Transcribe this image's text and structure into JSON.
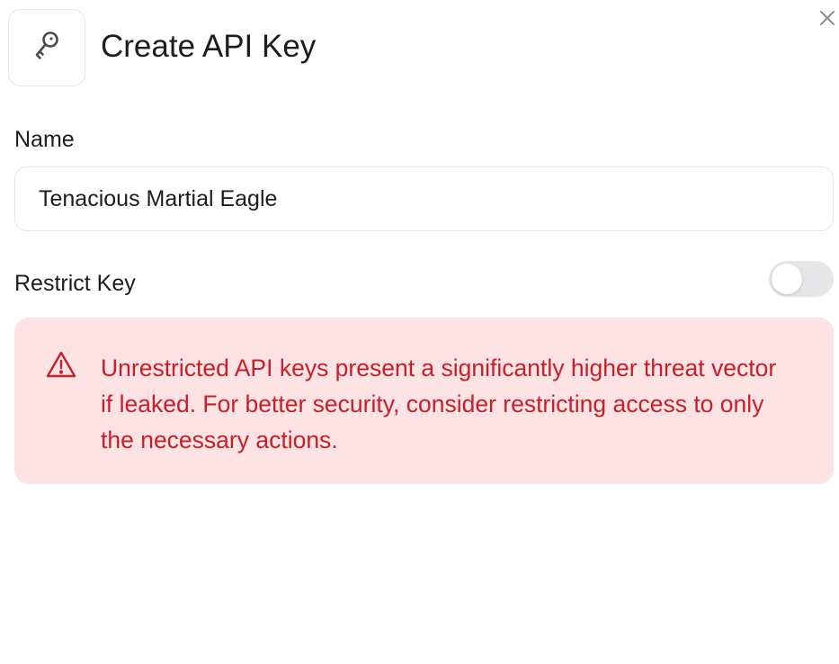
{
  "dialog": {
    "title": "Create API Key",
    "header_icon": "key-icon",
    "close_icon": "close-icon"
  },
  "name_field": {
    "label": "Name",
    "value": "Tenacious Martial Eagle"
  },
  "restrict": {
    "label": "Restrict Key",
    "enabled": false
  },
  "alert": {
    "icon": "warning-triangle-icon",
    "message": "Unrestricted API keys present a significantly higher threat vector if leaked. For better security, consider restricting access to only the necessary actions."
  },
  "colors": {
    "alert_background": "#fde3e3",
    "alert_text": "#c8202a",
    "toggle_off": "#e6e6e8",
    "border": "#e4e4e7"
  }
}
